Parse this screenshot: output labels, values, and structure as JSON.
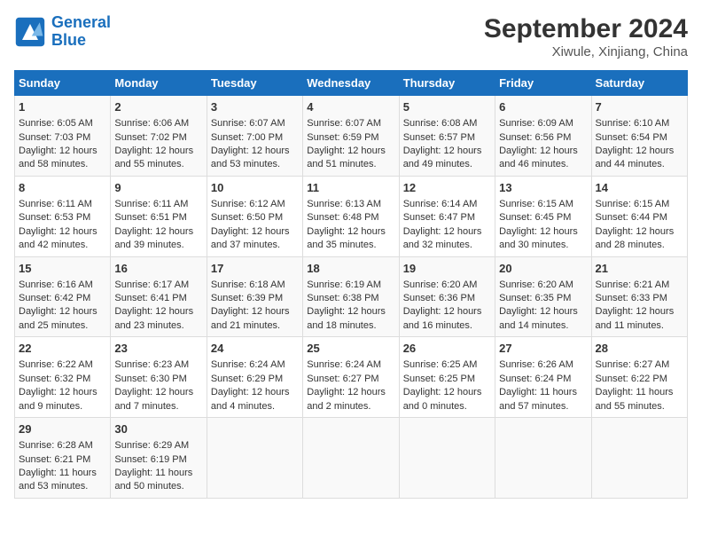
{
  "header": {
    "logo_line1": "General",
    "logo_line2": "Blue",
    "title": "September 2024",
    "subtitle": "Xiwule, Xinjiang, China"
  },
  "columns": [
    "Sunday",
    "Monday",
    "Tuesday",
    "Wednesday",
    "Thursday",
    "Friday",
    "Saturday"
  ],
  "weeks": [
    [
      {
        "day": "1",
        "sunrise": "Sunrise: 6:05 AM",
        "sunset": "Sunset: 7:03 PM",
        "daylight": "Daylight: 12 hours and 58 minutes."
      },
      {
        "day": "2",
        "sunrise": "Sunrise: 6:06 AM",
        "sunset": "Sunset: 7:02 PM",
        "daylight": "Daylight: 12 hours and 55 minutes."
      },
      {
        "day": "3",
        "sunrise": "Sunrise: 6:07 AM",
        "sunset": "Sunset: 7:00 PM",
        "daylight": "Daylight: 12 hours and 53 minutes."
      },
      {
        "day": "4",
        "sunrise": "Sunrise: 6:07 AM",
        "sunset": "Sunset: 6:59 PM",
        "daylight": "Daylight: 12 hours and 51 minutes."
      },
      {
        "day": "5",
        "sunrise": "Sunrise: 6:08 AM",
        "sunset": "Sunset: 6:57 PM",
        "daylight": "Daylight: 12 hours and 49 minutes."
      },
      {
        "day": "6",
        "sunrise": "Sunrise: 6:09 AM",
        "sunset": "Sunset: 6:56 PM",
        "daylight": "Daylight: 12 hours and 46 minutes."
      },
      {
        "day": "7",
        "sunrise": "Sunrise: 6:10 AM",
        "sunset": "Sunset: 6:54 PM",
        "daylight": "Daylight: 12 hours and 44 minutes."
      }
    ],
    [
      {
        "day": "8",
        "sunrise": "Sunrise: 6:11 AM",
        "sunset": "Sunset: 6:53 PM",
        "daylight": "Daylight: 12 hours and 42 minutes."
      },
      {
        "day": "9",
        "sunrise": "Sunrise: 6:11 AM",
        "sunset": "Sunset: 6:51 PM",
        "daylight": "Daylight: 12 hours and 39 minutes."
      },
      {
        "day": "10",
        "sunrise": "Sunrise: 6:12 AM",
        "sunset": "Sunset: 6:50 PM",
        "daylight": "Daylight: 12 hours and 37 minutes."
      },
      {
        "day": "11",
        "sunrise": "Sunrise: 6:13 AM",
        "sunset": "Sunset: 6:48 PM",
        "daylight": "Daylight: 12 hours and 35 minutes."
      },
      {
        "day": "12",
        "sunrise": "Sunrise: 6:14 AM",
        "sunset": "Sunset: 6:47 PM",
        "daylight": "Daylight: 12 hours and 32 minutes."
      },
      {
        "day": "13",
        "sunrise": "Sunrise: 6:15 AM",
        "sunset": "Sunset: 6:45 PM",
        "daylight": "Daylight: 12 hours and 30 minutes."
      },
      {
        "day": "14",
        "sunrise": "Sunrise: 6:15 AM",
        "sunset": "Sunset: 6:44 PM",
        "daylight": "Daylight: 12 hours and 28 minutes."
      }
    ],
    [
      {
        "day": "15",
        "sunrise": "Sunrise: 6:16 AM",
        "sunset": "Sunset: 6:42 PM",
        "daylight": "Daylight: 12 hours and 25 minutes."
      },
      {
        "day": "16",
        "sunrise": "Sunrise: 6:17 AM",
        "sunset": "Sunset: 6:41 PM",
        "daylight": "Daylight: 12 hours and 23 minutes."
      },
      {
        "day": "17",
        "sunrise": "Sunrise: 6:18 AM",
        "sunset": "Sunset: 6:39 PM",
        "daylight": "Daylight: 12 hours and 21 minutes."
      },
      {
        "day": "18",
        "sunrise": "Sunrise: 6:19 AM",
        "sunset": "Sunset: 6:38 PM",
        "daylight": "Daylight: 12 hours and 18 minutes."
      },
      {
        "day": "19",
        "sunrise": "Sunrise: 6:20 AM",
        "sunset": "Sunset: 6:36 PM",
        "daylight": "Daylight: 12 hours and 16 minutes."
      },
      {
        "day": "20",
        "sunrise": "Sunrise: 6:20 AM",
        "sunset": "Sunset: 6:35 PM",
        "daylight": "Daylight: 12 hours and 14 minutes."
      },
      {
        "day": "21",
        "sunrise": "Sunrise: 6:21 AM",
        "sunset": "Sunset: 6:33 PM",
        "daylight": "Daylight: 12 hours and 11 minutes."
      }
    ],
    [
      {
        "day": "22",
        "sunrise": "Sunrise: 6:22 AM",
        "sunset": "Sunset: 6:32 PM",
        "daylight": "Daylight: 12 hours and 9 minutes."
      },
      {
        "day": "23",
        "sunrise": "Sunrise: 6:23 AM",
        "sunset": "Sunset: 6:30 PM",
        "daylight": "Daylight: 12 hours and 7 minutes."
      },
      {
        "day": "24",
        "sunrise": "Sunrise: 6:24 AM",
        "sunset": "Sunset: 6:29 PM",
        "daylight": "Daylight: 12 hours and 4 minutes."
      },
      {
        "day": "25",
        "sunrise": "Sunrise: 6:24 AM",
        "sunset": "Sunset: 6:27 PM",
        "daylight": "Daylight: 12 hours and 2 minutes."
      },
      {
        "day": "26",
        "sunrise": "Sunrise: 6:25 AM",
        "sunset": "Sunset: 6:25 PM",
        "daylight": "Daylight: 12 hours and 0 minutes."
      },
      {
        "day": "27",
        "sunrise": "Sunrise: 6:26 AM",
        "sunset": "Sunset: 6:24 PM",
        "daylight": "Daylight: 11 hours and 57 minutes."
      },
      {
        "day": "28",
        "sunrise": "Sunrise: 6:27 AM",
        "sunset": "Sunset: 6:22 PM",
        "daylight": "Daylight: 11 hours and 55 minutes."
      }
    ],
    [
      {
        "day": "29",
        "sunrise": "Sunrise: 6:28 AM",
        "sunset": "Sunset: 6:21 PM",
        "daylight": "Daylight: 11 hours and 53 minutes."
      },
      {
        "day": "30",
        "sunrise": "Sunrise: 6:29 AM",
        "sunset": "Sunset: 6:19 PM",
        "daylight": "Daylight: 11 hours and 50 minutes."
      },
      {
        "day": "",
        "sunrise": "",
        "sunset": "",
        "daylight": ""
      },
      {
        "day": "",
        "sunrise": "",
        "sunset": "",
        "daylight": ""
      },
      {
        "day": "",
        "sunrise": "",
        "sunset": "",
        "daylight": ""
      },
      {
        "day": "",
        "sunrise": "",
        "sunset": "",
        "daylight": ""
      },
      {
        "day": "",
        "sunrise": "",
        "sunset": "",
        "daylight": ""
      }
    ]
  ]
}
